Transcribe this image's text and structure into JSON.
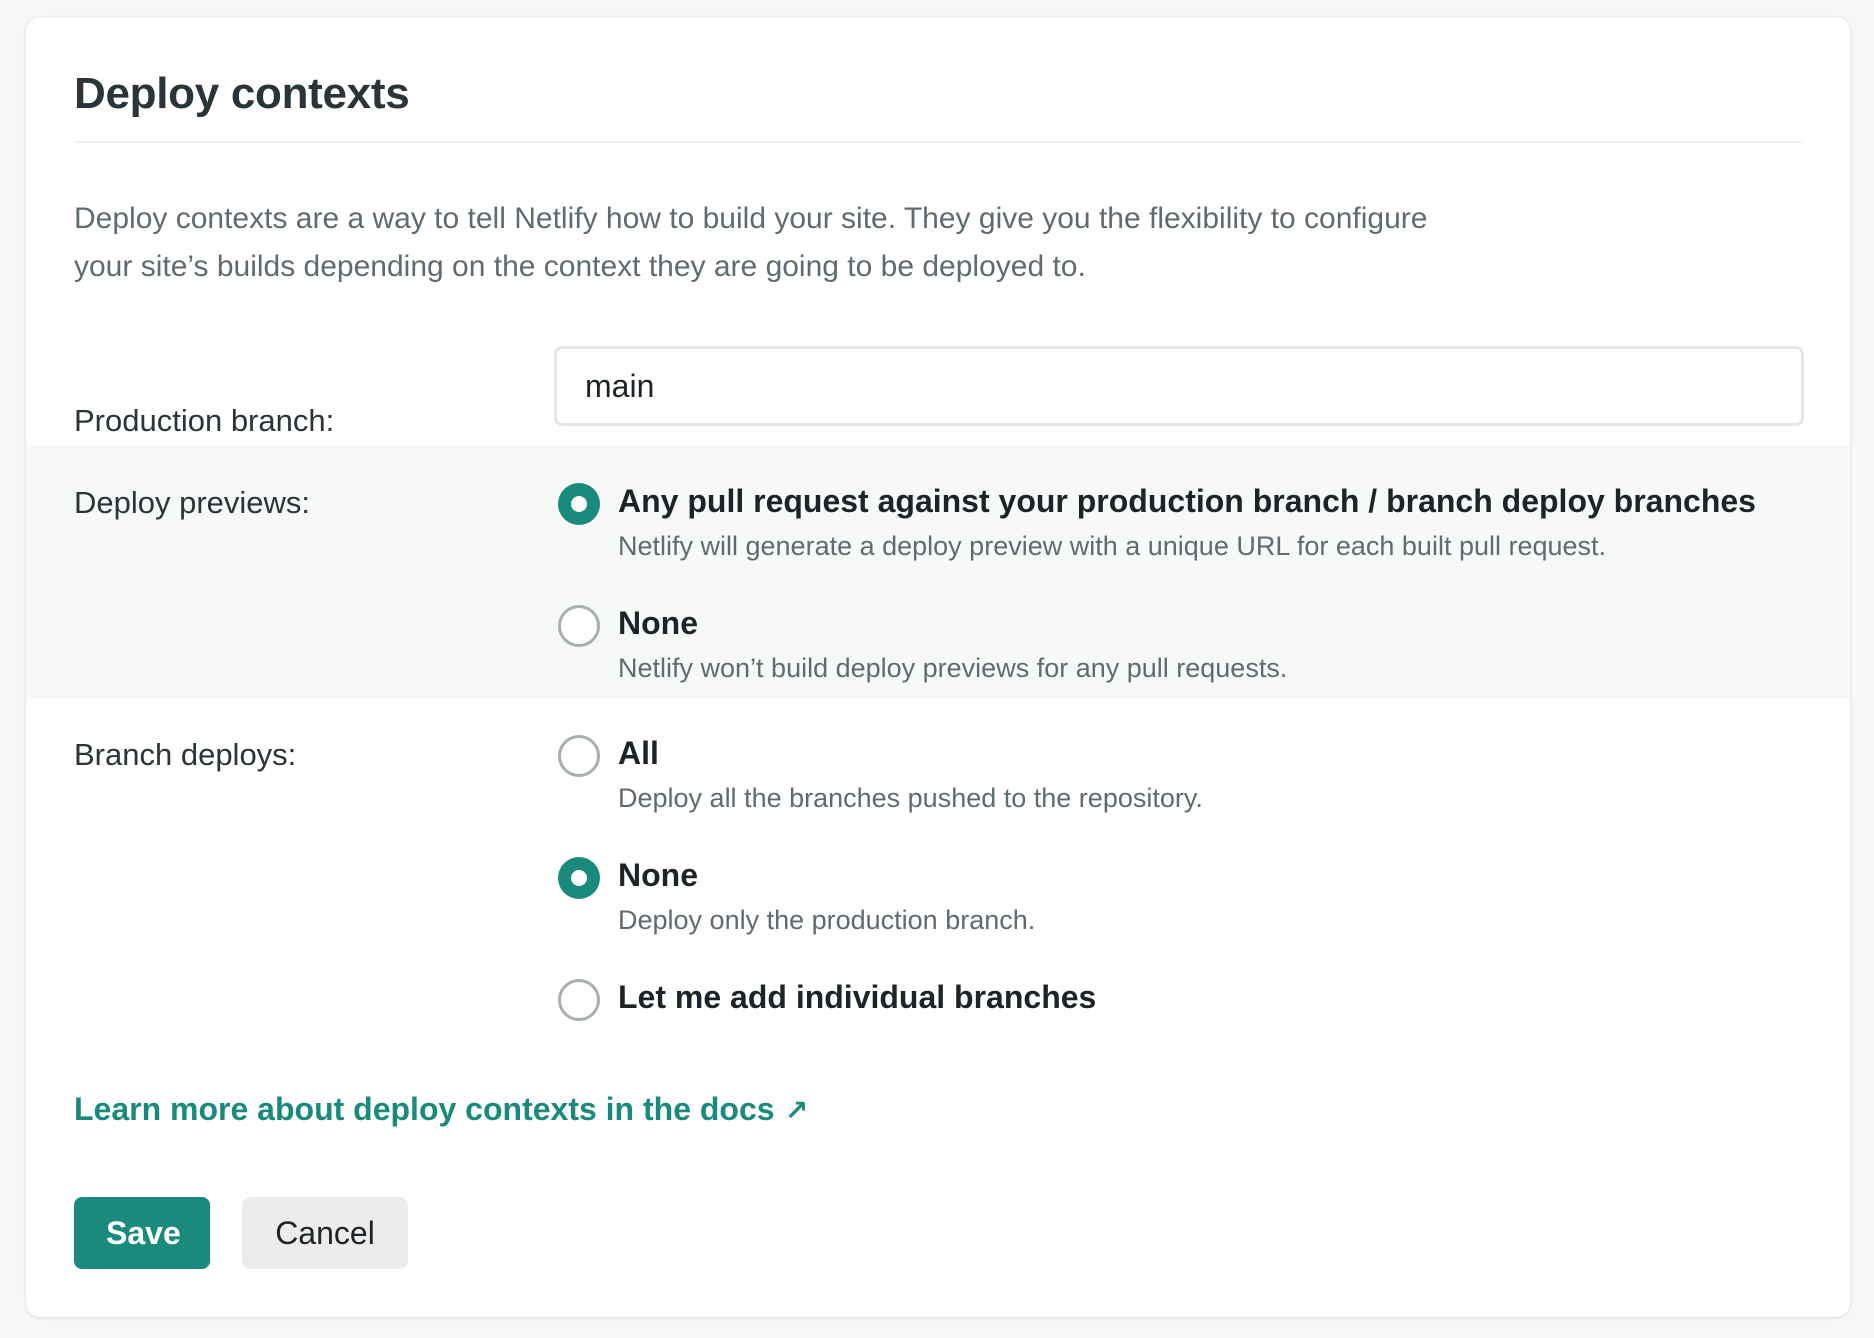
{
  "card": {
    "title": "Deploy contexts",
    "description": "Deploy contexts are a way to tell Netlify how to build your site. They give you the flexibility to configure your site’s builds depending on the context they are going to be deployed to."
  },
  "production_branch": {
    "label": "Production branch:",
    "value": "main"
  },
  "deploy_previews": {
    "label": "Deploy previews:",
    "selected": "any_pull_request",
    "options": [
      {
        "id": "any_pull_request",
        "title": "Any pull request against your production branch / branch deploy branches",
        "description": "Netlify will generate a deploy preview with a unique URL for each built pull request."
      },
      {
        "id": "none",
        "title": "None",
        "description": "Netlify won’t build deploy previews for any pull requests."
      }
    ]
  },
  "branch_deploys": {
    "label": "Branch deploys:",
    "selected": "none",
    "options": [
      {
        "id": "all",
        "title": "All",
        "description": "Deploy all the branches pushed to the repository."
      },
      {
        "id": "none",
        "title": "None",
        "description": "Deploy only the production branch."
      },
      {
        "id": "individual",
        "title": "Let me add individual branches",
        "description": ""
      }
    ]
  },
  "docs_link": {
    "label": "Learn more about deploy contexts in the docs",
    "icon": "external-arrow-icon",
    "glyph": "↗"
  },
  "actions": {
    "save_label": "Save",
    "cancel_label": "Cancel"
  },
  "colors": {
    "accent": "#1a8a7c",
    "radio_unchecked_border": "#a7afb2",
    "shaded_band": "#f7f9f9",
    "cancel_bg": "#ececec"
  }
}
